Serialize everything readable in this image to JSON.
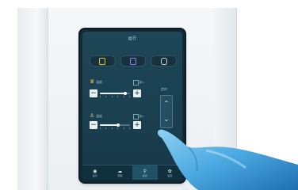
{
  "screen": {
    "title": "运行",
    "modes": [
      {
        "name": "mode-1",
        "icon": "moon-icon",
        "color": "#e2c23a"
      },
      {
        "name": "mode-2",
        "icon": "square-icon",
        "color": "#8f7fe0"
      },
      {
        "name": "mode-3",
        "icon": "cup-icon",
        "color": "#cfd9de"
      }
    ],
    "controls": [
      {
        "label": "温度",
        "icon": "crown-icon",
        "value_text": "0~",
        "level": 0.85
      },
      {
        "label": "湿度",
        "icon": "anchor-icon",
        "value_text": "0~",
        "level": 0.6
      }
    ],
    "side_label": "定时",
    "nav": [
      {
        "label": "运行",
        "icon": "eye-icon"
      },
      {
        "label": "智能",
        "icon": "cloud-icon"
      },
      {
        "label": "模式",
        "icon": "faucet-icon"
      },
      {
        "label": "设置",
        "icon": "gear-icon"
      }
    ]
  }
}
